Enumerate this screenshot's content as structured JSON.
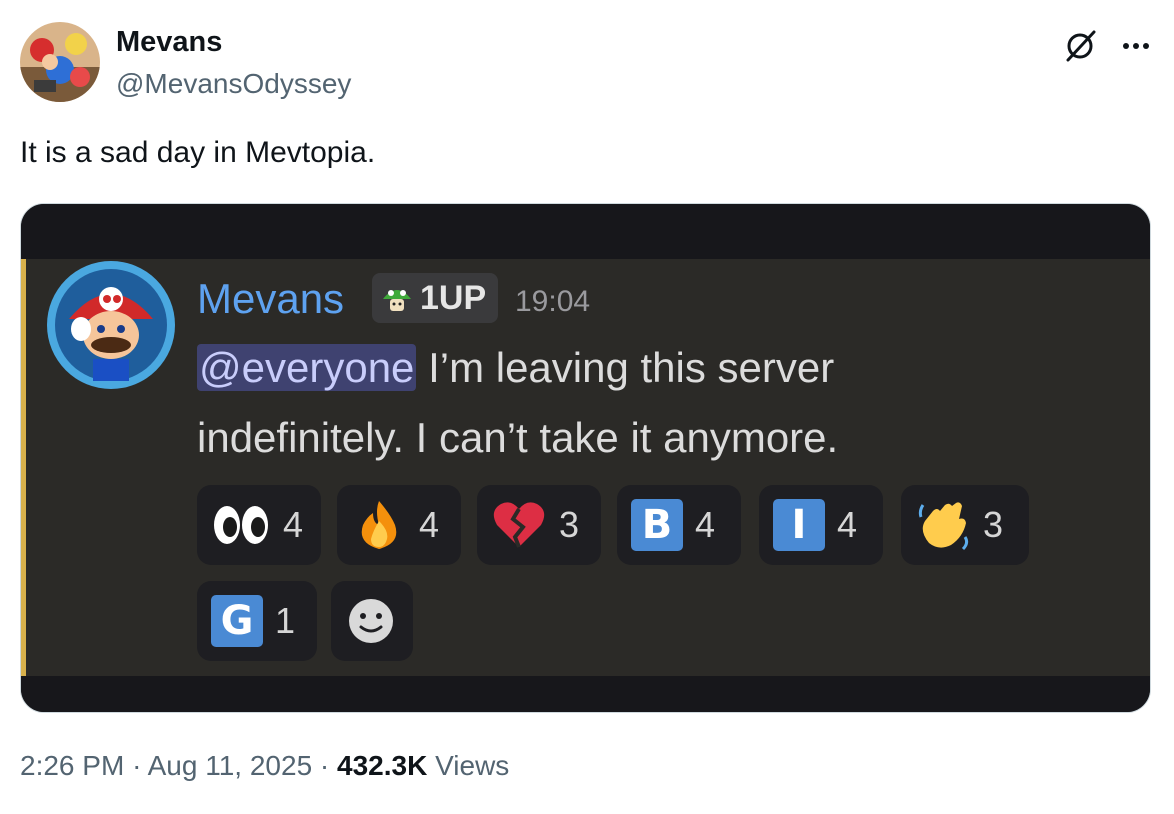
{
  "tweet": {
    "author_name": "Mevans",
    "author_handle": "@MevansOdyssey",
    "text": "It is a sad day in Mevtopia.",
    "time": "2:26 PM",
    "separator": "·",
    "date": "Aug 11, 2025",
    "views_count": "432.3K",
    "views_label": "Views",
    "icons": [
      "grok-icon",
      "more-icon"
    ]
  },
  "discord": {
    "username": "Mevans",
    "tag_label": "1UP",
    "timestamp": "19:04",
    "mention": "@everyone",
    "message_line1": " I’m leaving this server",
    "message_line2": "indefinitely. I can’t take it anymore.",
    "colors": {
      "username": "#5ea2f0",
      "mention_bg": "#3f4270",
      "mention_bar": "#d8b14c",
      "badge_blue": "#4a8ad4"
    },
    "reactions": [
      {
        "icon": "eyes-emoji",
        "count": "4"
      },
      {
        "icon": "fire-emoji",
        "count": "4"
      },
      {
        "icon": "broken-heart-emoji",
        "count": "3"
      },
      {
        "icon": "letter-b-emoji",
        "letter": "B",
        "count": "4"
      },
      {
        "icon": "letter-i-emoji",
        "letter": "I",
        "count": "4"
      },
      {
        "icon": "waving-hand-emoji",
        "count": "3"
      },
      {
        "icon": "letter-g-emoji",
        "letter": "G",
        "count": "1"
      },
      {
        "icon": "add-reaction-icon"
      }
    ]
  }
}
